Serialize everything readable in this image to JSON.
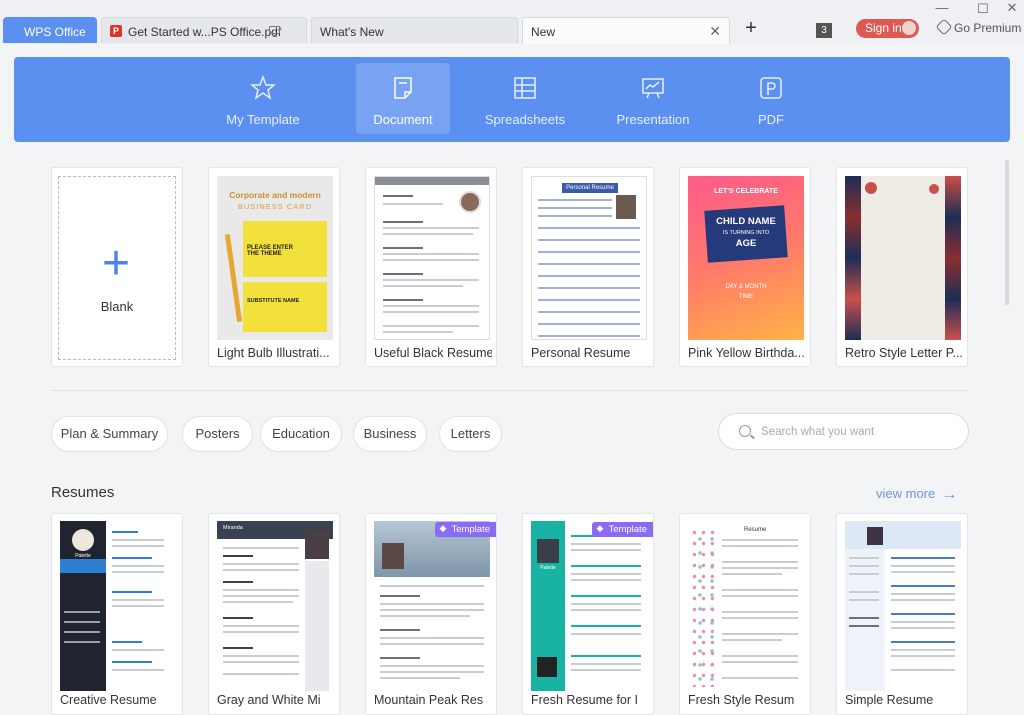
{
  "tabs": [
    {
      "label": "WPS Office"
    },
    {
      "label": "Get Started w...PS Office.pdf"
    },
    {
      "label": "What's New"
    },
    {
      "label": "New"
    }
  ],
  "window": {
    "tab_count": "3",
    "sign_in": "Sign in",
    "premium": "Go Premium"
  },
  "categories": [
    {
      "label": "My Template",
      "icon": "star-icon"
    },
    {
      "label": "Document",
      "icon": "document-icon"
    },
    {
      "label": "Spreadsheets",
      "icon": "spreadsheet-icon"
    },
    {
      "label": "Presentation",
      "icon": "presentation-icon"
    },
    {
      "label": "PDF",
      "icon": "pdf-icon"
    }
  ],
  "templates": [
    {
      "label": "Blank"
    },
    {
      "label": "Light Bulb Illustrati..."
    },
    {
      "label": "Useful Black Resume"
    },
    {
      "label": "Personal Resume"
    },
    {
      "label": "Pink Yellow Birthda..."
    },
    {
      "label": "Retro Style Letter P..."
    }
  ],
  "thumb_text": {
    "business_title": "Corporate and modern",
    "business_sub": "BUSINESS CARD",
    "please_enter": "PLEASE ENTER THE THEME",
    "substitute": "SUBSTITUTE NAME",
    "personal_resume": "Personal Resume",
    "lets_celebrate": "LET'S CELEBRATE",
    "child_name": "CHILD NAME",
    "turning": "IS TURNING INTO",
    "age": "AGE",
    "day_month": "DAY & MONTH",
    "time": "TIME",
    "gray_white_name": "Miranda",
    "palette_name": "Palette",
    "resume_word": "Resume"
  },
  "filters": [
    "Plan & Summary",
    "Posters",
    "Education",
    "Business",
    "Letters"
  ],
  "search": {
    "placeholder": "Search what you want",
    "value": ""
  },
  "section": {
    "title": "Resumes",
    "view_more": "view more"
  },
  "resumes": [
    {
      "label": "Creative Resume",
      "badge": ""
    },
    {
      "label": "Gray and White Mi",
      "badge": ""
    },
    {
      "label": "Mountain Peak Res",
      "badge": "Template"
    },
    {
      "label": "Fresh Resume for I",
      "badge": "Template"
    },
    {
      "label": "Fresh Style Resum",
      "badge": ""
    },
    {
      "label": "Simple Resume",
      "badge": ""
    }
  ],
  "colors": {
    "accent": "#5b8ff0",
    "sign_in": "#dd5a52",
    "badge": "#8a6cf2",
    "view_more": "#6d95e0"
  }
}
